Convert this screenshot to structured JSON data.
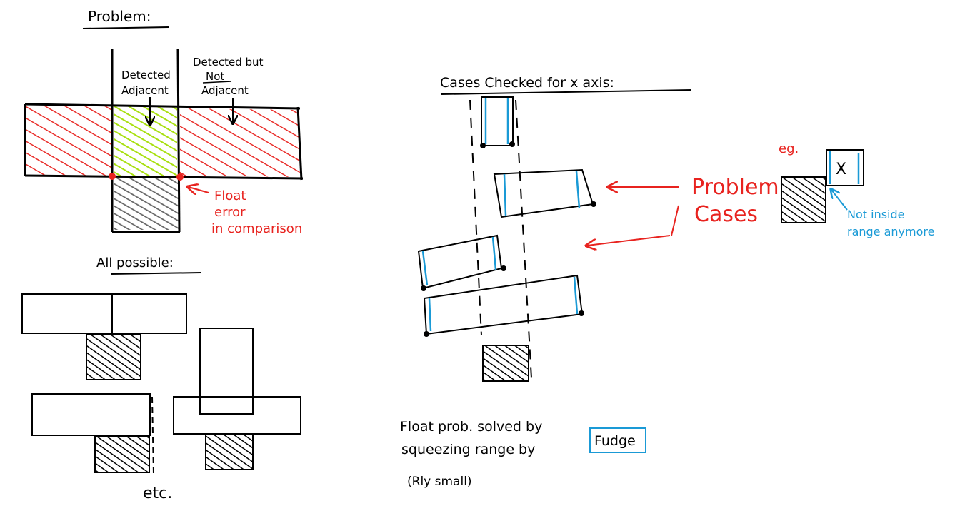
{
  "colors": {
    "ink": "#000000",
    "red": "#e8231f",
    "green": "#a8e010",
    "gray": "#666666",
    "blue": "#1a9ad6"
  },
  "problem_section": {
    "title": "Problem:",
    "detected_adjacent_label": [
      "Detected",
      "Adjacent"
    ],
    "detected_not_adjacent_label": [
      "Detected but",
      "Not",
      "Adjacent"
    ],
    "float_error_label": [
      "Float",
      "error",
      "in comparison"
    ]
  },
  "all_possible_section": {
    "title": "All possible:",
    "etc_label": "etc."
  },
  "cases_section": {
    "title": "Cases Checked for x axis:",
    "problem_cases_label": [
      "Problem",
      "Cases"
    ],
    "eg_label": "eg.",
    "x_mark": "X",
    "not_inside_label": [
      "Not inside",
      "range anymore"
    ]
  },
  "footer_note": {
    "line1": "Float prob. solved by",
    "line2_prefix": "squeezing range by",
    "fudge_word": "Fudge",
    "line3": "(Rly small)"
  }
}
